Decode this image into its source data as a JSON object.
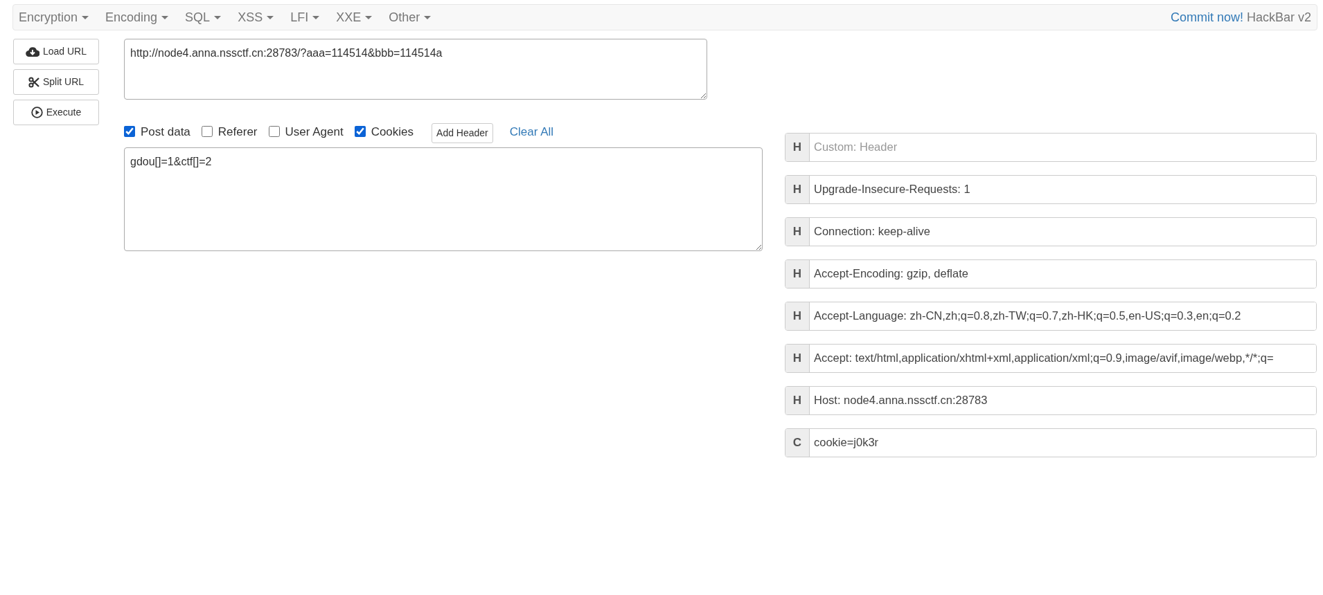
{
  "menu": [
    {
      "label": "Encryption"
    },
    {
      "label": "Encoding"
    },
    {
      "label": "SQL"
    },
    {
      "label": "XSS"
    },
    {
      "label": "LFI"
    },
    {
      "label": "XXE"
    },
    {
      "label": "Other"
    }
  ],
  "brand": {
    "link": "Commit now!",
    "title": "HackBar v2"
  },
  "actions": [
    {
      "kind": "load",
      "label": "Load URL"
    },
    {
      "kind": "split",
      "label": "Split URL"
    },
    {
      "kind": "execute",
      "label": "Execute"
    }
  ],
  "url": {
    "value": "http://node4.anna.nssctf.cn:28783/?aaa=114514&bbb=114514a"
  },
  "options": [
    {
      "label": "Post data",
      "checked": true
    },
    {
      "label": "Referer",
      "checked": false
    },
    {
      "label": "User Agent",
      "checked": false
    },
    {
      "label": "Cookies",
      "checked": true
    }
  ],
  "add_header": "Add Header",
  "clear_all": "Clear All",
  "post_data": {
    "value": "gdou[]=1&ctf[]=2"
  },
  "headers": [
    {
      "tag": "H",
      "placeholder": "Custom: Header"
    },
    {
      "tag": "H",
      "value": "Upgrade-Insecure-Requests: 1"
    },
    {
      "tag": "H",
      "value": "Connection: keep-alive"
    },
    {
      "tag": "H",
      "value": "Accept-Encoding: gzip, deflate"
    },
    {
      "tag": "H",
      "value": "Accept-Language: zh-CN,zh;q=0.8,zh-TW;q=0.7,zh-HK;q=0.5,en-US;q=0.3,en;q=0.2"
    },
    {
      "tag": "H",
      "value": "Accept: text/html,application/xhtml+xml,application/xml;q=0.9,image/avif,image/webp,*/*;q="
    },
    {
      "tag": "H",
      "value": "Host: node4.anna.nssctf.cn:28783"
    },
    {
      "tag": "C",
      "value": "cookie=j0k3r"
    }
  ]
}
